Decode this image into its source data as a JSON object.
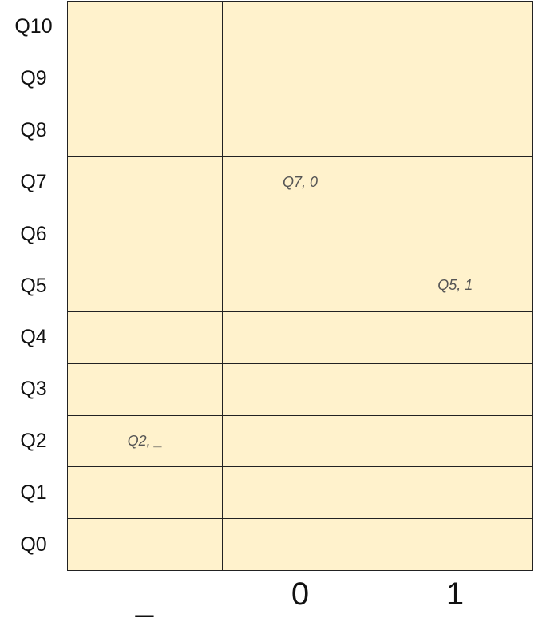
{
  "rows": [
    "Q10",
    "Q9",
    "Q8",
    "Q7",
    "Q6",
    "Q5",
    "Q4",
    "Q3",
    "Q2",
    "Q1",
    "Q0"
  ],
  "columns": [
    "_",
    "0",
    "1"
  ],
  "cells": [
    {
      "row": "Q7",
      "column": "0",
      "text": "Q7, 0"
    },
    {
      "row": "Q5",
      "column": "1",
      "text": "Q5, 1"
    },
    {
      "row": "Q2",
      "column": "_",
      "text": "Q2, _"
    }
  ],
  "colors": {
    "cell_fill": "#fff2cc",
    "grid_line": "#222222",
    "cell_text": "#555555",
    "label_text": "#111111"
  }
}
